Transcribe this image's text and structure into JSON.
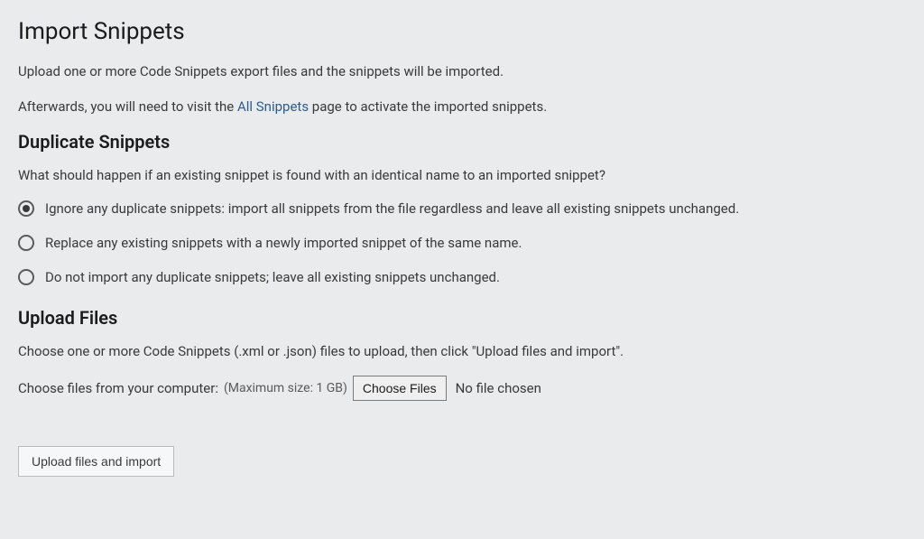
{
  "title": "Import Snippets",
  "intro": {
    "line1": "Upload one or more Code Snippets export files and the snippets will be imported.",
    "line2_before": "Afterwards, you will need to visit the ",
    "line2_link": "All Snippets",
    "line2_after": " page to activate the imported snippets."
  },
  "duplicates": {
    "heading": "Duplicate Snippets",
    "question": "What should happen if an existing snippet is found with an identical name to an imported snippet?",
    "options": {
      "ignore": "Ignore any duplicate snippets: import all snippets from the file regardless and leave all existing snippets unchanged.",
      "replace": "Replace any existing snippets with a newly imported snippet of the same name.",
      "skip": "Do not import any duplicate snippets; leave all existing snippets unchanged."
    },
    "selected": "ignore"
  },
  "upload": {
    "heading": "Upload Files",
    "instructions": "Choose one or more Code Snippets (.xml or .json) files to upload, then click \"Upload files and import\".",
    "choose_label": "Choose files from your computer:",
    "max_size": "(Maximum size: 1 GB)",
    "choose_button": "Choose Files",
    "no_file": "No file chosen",
    "submit_button": "Upload files and import"
  }
}
